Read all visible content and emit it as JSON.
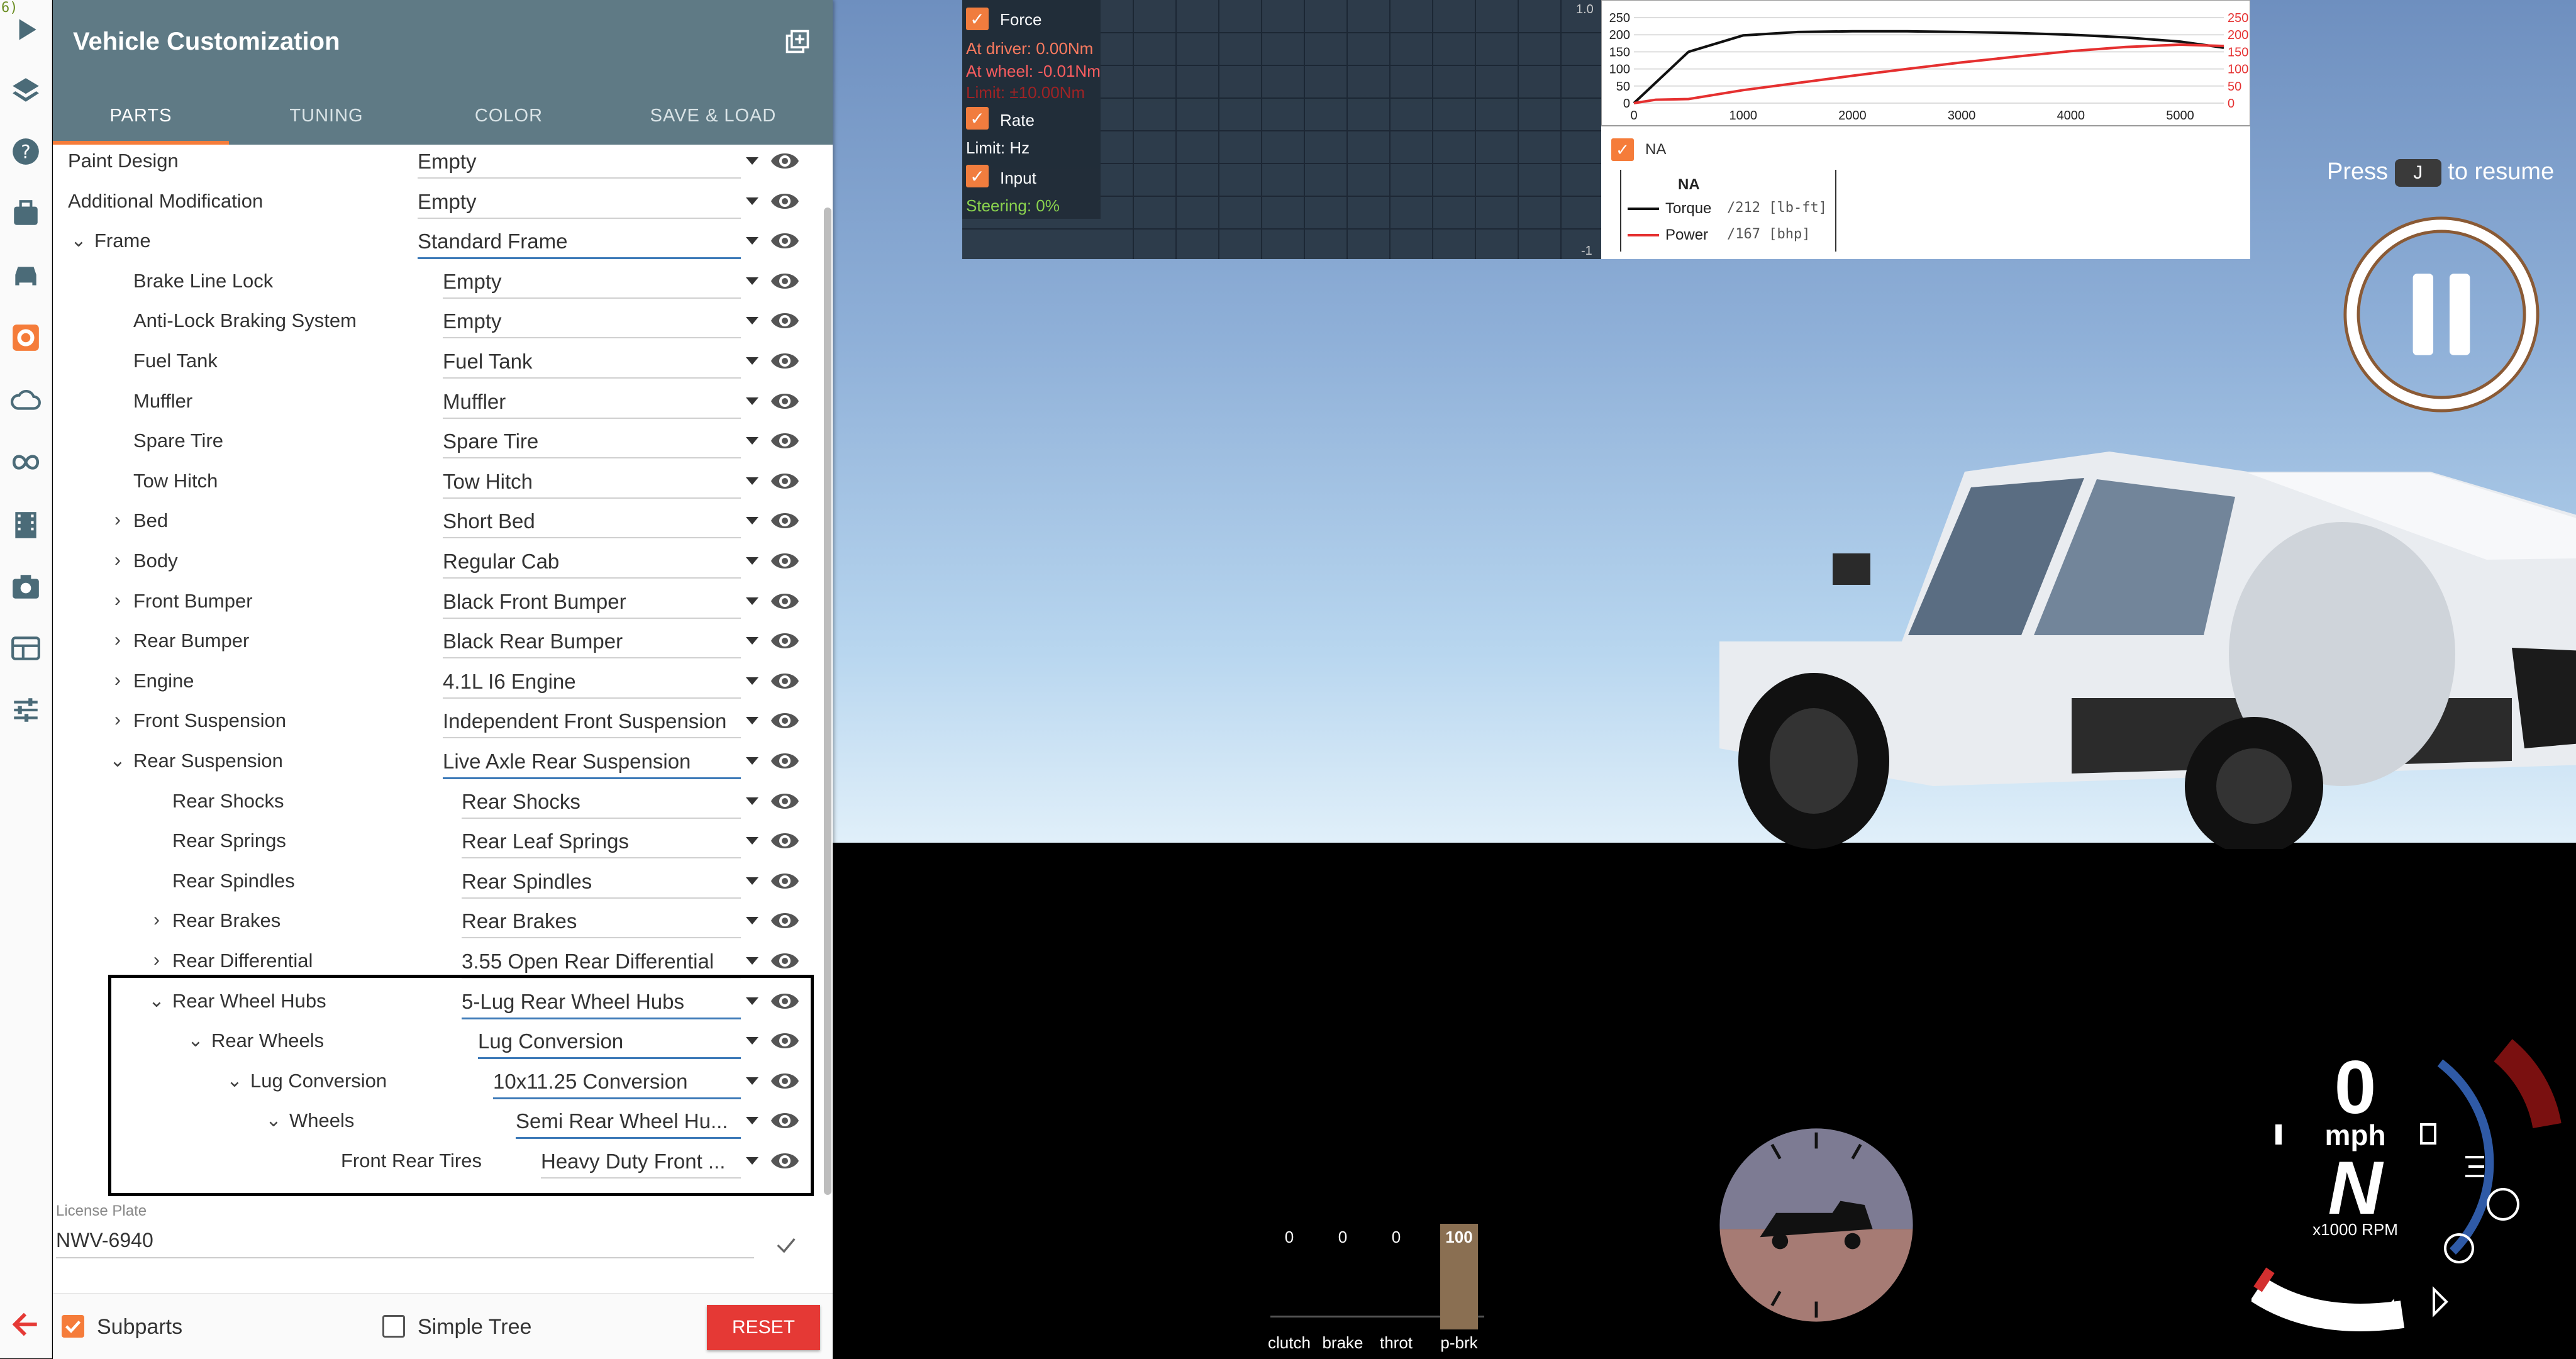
{
  "rail": {
    "tag": "6)",
    "icons": [
      "play-icon",
      "layers-icon",
      "help-icon",
      "missions-icon",
      "vehicles-icon",
      "vehicle-config-icon",
      "environment-icon",
      "ai-icon",
      "replay-icon",
      "photo-mode-icon",
      "ui-apps-icon",
      "options-icon"
    ]
  },
  "panel": {
    "title": "Vehicle Customization",
    "tabs": [
      "PARTS",
      "TUNING",
      "COLOR",
      "SAVE & LOAD"
    ],
    "active_tab": "PARTS",
    "rows": [
      {
        "label": "Paint Design",
        "value": "Empty",
        "level": 0,
        "expand": ""
      },
      {
        "label": "Additional Modification",
        "value": "Empty",
        "level": 0,
        "expand": ""
      },
      {
        "label": "Frame",
        "value": "Standard Frame",
        "level": 0,
        "expand": "open"
      },
      {
        "label": "Brake Line Lock",
        "value": "Empty",
        "level": 1,
        "expand": ""
      },
      {
        "label": "Anti-Lock Braking System",
        "value": "Empty",
        "level": 1,
        "expand": ""
      },
      {
        "label": "Fuel Tank",
        "value": "Fuel Tank",
        "level": 1,
        "expand": ""
      },
      {
        "label": "Muffler",
        "value": "Muffler",
        "level": 1,
        "expand": ""
      },
      {
        "label": "Spare Tire",
        "value": "Spare Tire",
        "level": 1,
        "expand": ""
      },
      {
        "label": "Tow Hitch",
        "value": "Tow Hitch",
        "level": 1,
        "expand": ""
      },
      {
        "label": "Bed",
        "value": "Short Bed",
        "level": 1,
        "expand": "closed"
      },
      {
        "label": "Body",
        "value": "Regular Cab",
        "level": 1,
        "expand": "closed"
      },
      {
        "label": "Front Bumper",
        "value": "Black Front Bumper",
        "level": 1,
        "expand": "closed"
      },
      {
        "label": "Rear Bumper",
        "value": "Black Rear Bumper",
        "level": 1,
        "expand": "closed"
      },
      {
        "label": "Engine",
        "value": "4.1L I6 Engine",
        "level": 1,
        "expand": "closed"
      },
      {
        "label": "Front Suspension",
        "value": "Independent Front Suspension",
        "level": 1,
        "expand": "closed"
      },
      {
        "label": "Rear Suspension",
        "value": "Live Axle Rear Suspension",
        "level": 1,
        "expand": "open"
      },
      {
        "label": "Rear Shocks",
        "value": "Rear Shocks",
        "level": 2,
        "expand": ""
      },
      {
        "label": "Rear Springs",
        "value": "Rear Leaf Springs",
        "level": 2,
        "expand": ""
      },
      {
        "label": "Rear Spindles",
        "value": "Rear Spindles",
        "level": 2,
        "expand": ""
      },
      {
        "label": "Rear Brakes",
        "value": "Rear Brakes",
        "level": 2,
        "expand": "closed"
      },
      {
        "label": "Rear Differential",
        "value": "3.55 Open Rear Differential",
        "level": 2,
        "expand": "closed"
      },
      {
        "label": "Rear Wheel Hubs",
        "value": "5-Lug Rear Wheel Hubs",
        "level": 2,
        "expand": "open"
      },
      {
        "label": "Rear Wheels",
        "value": "Lug Conversion",
        "level": 3,
        "expand": "open"
      },
      {
        "label": "Lug Conversion",
        "value": "10x11.25 Conversion",
        "level": 4,
        "expand": "open"
      },
      {
        "label": "Wheels",
        "value": "Semi Rear Wheel Hu...",
        "level": 5,
        "expand": "open"
      },
      {
        "label": "Front Rear Tires",
        "value": "Heavy Duty Front ...",
        "level": 6,
        "expand": ""
      }
    ],
    "license_plate": {
      "label": "License Plate",
      "value": "NWV-6940"
    },
    "footer": {
      "subparts_label": "Subparts",
      "subparts_checked": true,
      "simple_tree_label": "Simple Tree",
      "simple_tree_checked": false,
      "reset_label": "RESET"
    }
  },
  "force_panel": {
    "force_label": "Force",
    "at_driver": "At driver: 0.00Nm",
    "at_wheel": "At wheel: -0.01Nm",
    "limit_force": "Limit: ±10.00Nm",
    "rate_label": "Rate",
    "rate_limit": "Limit: Hz",
    "input_label": "Input",
    "steering": "Steering: 0%",
    "axis_top": "1.0",
    "axis_bottom": "-1"
  },
  "torque_graph": {
    "left_ticks": [
      "250",
      "200",
      "150",
      "100",
      "50",
      "0"
    ],
    "right_ticks": [
      "250",
      "200",
      "150",
      "100",
      "50",
      "0"
    ],
    "x_ticks": [
      "0",
      "1000",
      "2000",
      "3000",
      "4000",
      "5000"
    ],
    "na_label": "NA",
    "legend_header": "NA",
    "torque_label": "Torque",
    "torque_value": "/212 [lb-ft]",
    "power_label": "Power",
    "power_value": "/167 [bhp]",
    "torque_color": "#111111",
    "power_color": "#e53030"
  },
  "chart_data": {
    "type": "line",
    "x": [
      0,
      200,
      500,
      1000,
      1500,
      2000,
      2500,
      3000,
      3500,
      4000,
      4500,
      5000,
      5400
    ],
    "series": [
      {
        "name": "Torque",
        "values": [
          0,
          60,
          150,
          198,
          208,
          210,
          210,
          208,
          205,
          200,
          192,
          180,
          162
        ]
      },
      {
        "name": "Power",
        "values": [
          0,
          10,
          12,
          38,
          59,
          80,
          100,
          119,
          136,
          152,
          164,
          171,
          167
        ]
      }
    ],
    "xlim": [
      0,
      5400
    ],
    "ylim": [
      0,
      250
    ]
  },
  "hud": {
    "press_text_pre": "Press",
    "press_key": "J",
    "press_text_post": "to resume",
    "inputs": [
      {
        "label": "clutch",
        "value": "0"
      },
      {
        "label": "brake",
        "value": "0"
      },
      {
        "label": "throt",
        "value": "0"
      },
      {
        "label": "p-brk",
        "value": "100"
      }
    ],
    "pbrk_fill": 1.0,
    "speed": "0",
    "speed_unit": "mph",
    "gear": "N",
    "rpm_label": "x1000 RPM"
  },
  "colors": {
    "accent": "#f57c3a",
    "header": "#5f7a85",
    "reset": "#e53935",
    "select_underline": "#3d7ab8"
  }
}
